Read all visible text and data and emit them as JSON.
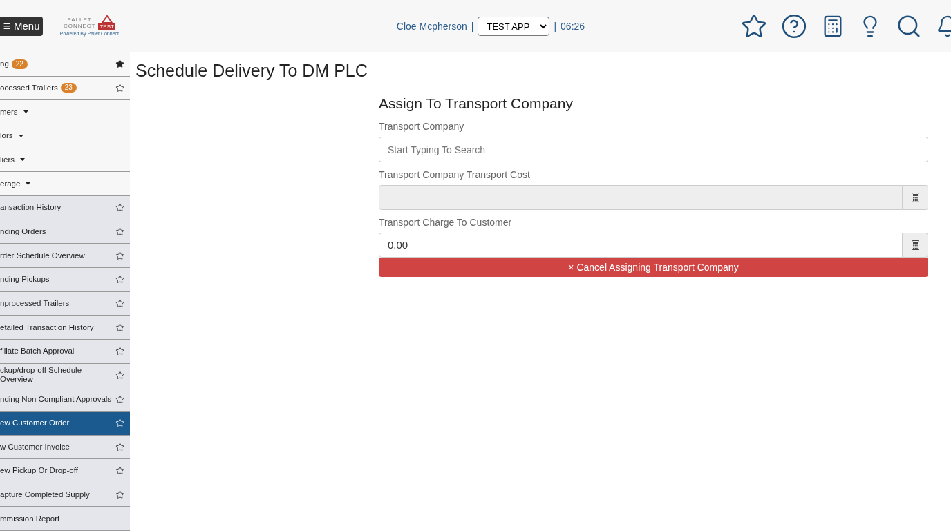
{
  "header": {
    "menu_button": "Menu",
    "logo_text": [
      "PALLET",
      "CONNECT"
    ],
    "logo_badge": "TEST",
    "powered_by": "Powered By Pallet Connect",
    "user": "Cloe Mcpherson",
    "separator_1": "|",
    "app_select": "TEST APP",
    "separator_2": "|",
    "time": "06:26"
  },
  "sidebar": {
    "items": [
      {
        "kind": "link",
        "label": "ng",
        "badge": "22",
        "starred": true,
        "selected": false,
        "shaded": false
      },
      {
        "kind": "link",
        "label": "ocessed Trailers",
        "badge": "23",
        "starred": false,
        "selected": false,
        "shaded": false
      },
      {
        "kind": "dropdown",
        "label": "mers",
        "selected": false,
        "shaded": false
      },
      {
        "kind": "dropdown",
        "label": "lors",
        "selected": false,
        "shaded": false
      },
      {
        "kind": "dropdown",
        "label": "liers",
        "selected": false,
        "shaded": false
      },
      {
        "kind": "dropdown",
        "label": "erage",
        "selected": false,
        "shaded": false
      },
      {
        "kind": "link",
        "label": "ansaction History",
        "starred": false,
        "selected": false,
        "shaded": true
      },
      {
        "kind": "link",
        "label": "nding Orders",
        "starred": false,
        "selected": false,
        "shaded": true
      },
      {
        "kind": "link",
        "label": "rder Schedule Overview",
        "starred": false,
        "selected": false,
        "shaded": true
      },
      {
        "kind": "link",
        "label": "nding Pickups",
        "starred": false,
        "selected": false,
        "shaded": true
      },
      {
        "kind": "link",
        "label": "nprocessed Trailers",
        "starred": false,
        "selected": false,
        "shaded": true
      },
      {
        "kind": "link",
        "label": "etailed Transaction History",
        "starred": false,
        "selected": false,
        "shaded": true
      },
      {
        "kind": "link",
        "label": "filiate Batch Approval",
        "starred": false,
        "selected": false,
        "shaded": true
      },
      {
        "kind": "link",
        "label": "ckup/drop-off Schedule Overview",
        "starred": false,
        "selected": false,
        "shaded": true
      },
      {
        "kind": "link",
        "label": "nding Non Compliant Approvals",
        "starred": false,
        "selected": false,
        "shaded": true
      },
      {
        "kind": "link",
        "label": "ew Customer Order",
        "starred": false,
        "selected": true
      },
      {
        "kind": "link",
        "label": "w Customer Invoice",
        "starred": false,
        "selected": false,
        "shaded": true
      },
      {
        "kind": "link",
        "label": "ew Pickup Or Drop-off",
        "starred": false,
        "selected": false,
        "shaded": true
      },
      {
        "kind": "link",
        "label": "apture Completed Supply",
        "starred": false,
        "selected": false,
        "shaded": true
      },
      {
        "kind": "plain",
        "label": "mmission Report",
        "selected": false,
        "shaded": true
      }
    ]
  },
  "page": {
    "title": "Schedule Delivery To DM PLC",
    "form": {
      "heading": "Assign To Transport Company",
      "fields": [
        {
          "kind": "search",
          "label": "Transport Company",
          "placeholder": "Start Typing To Search",
          "disabled": false
        },
        {
          "kind": "calc",
          "label": "Transport Company Transport Cost",
          "disabled": true
        },
        {
          "kind": "calc",
          "label": "Transport Charge To Customer",
          "value": "0.00",
          "disabled": false
        }
      ],
      "cancel_button": "× Cancel Assigning Transport Company"
    }
  }
}
